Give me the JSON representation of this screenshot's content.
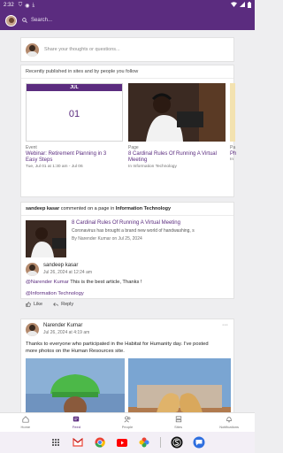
{
  "status_bar": {
    "time": "2:32"
  },
  "header": {
    "search_placeholder": "Search..."
  },
  "compose": {
    "placeholder": "Share your thoughts or questions..."
  },
  "recent": {
    "title": "Recently published in sites and by people you follow",
    "event": {
      "month": "JUL",
      "day": "01",
      "type": "Event",
      "title_line1": "Webinar: Retirement Planning in 3",
      "title_line2": "Easy Steps",
      "date": "Tue, Jul 01 at 1:30 am - Jul 06"
    },
    "page": {
      "type": "Page",
      "title_line1": "8 Cardinal Rules Of Running A Virtual",
      "title_line2": "Meeting",
      "site": "In Information Technology"
    },
    "peek": {
      "type": "Pa",
      "title": "Ph",
      "sub": "In"
    }
  },
  "activity": {
    "actor": "sandeep kasar",
    "action": " commented on a page in ",
    "site": "Information Technology",
    "linked": {
      "title": "8 Cardinal Rules Of Running A Virtual Meeting",
      "description": "Coronavirus has brought a brand new world of handwashing, s",
      "meta": "By Narender Kumar on Jul 25, 2024"
    },
    "comment": {
      "name": "sandeep kasar",
      "date": "Jul 26, 2024 at 12:24 am",
      "mention": "@Narender Kumar",
      "text": " This is the best article, Thanks !",
      "mention2": "@Information Technology",
      "like": "Like",
      "reply": "Reply"
    }
  },
  "post": {
    "name": "Narender Kumar",
    "date": "Jul 26, 2024 at 4:19 am",
    "more": "···",
    "text_line1": "Thanks to everyone who participated in the Habitat for Humanity day. I've posted",
    "text_line2": "more photos on the Human Resources site."
  },
  "tabs": [
    {
      "label": "Home"
    },
    {
      "label": "Feed"
    },
    {
      "label": "People"
    },
    {
      "label": "Sites"
    },
    {
      "label": "Notifications"
    }
  ],
  "colors": {
    "brand": "#5b2c7f"
  }
}
